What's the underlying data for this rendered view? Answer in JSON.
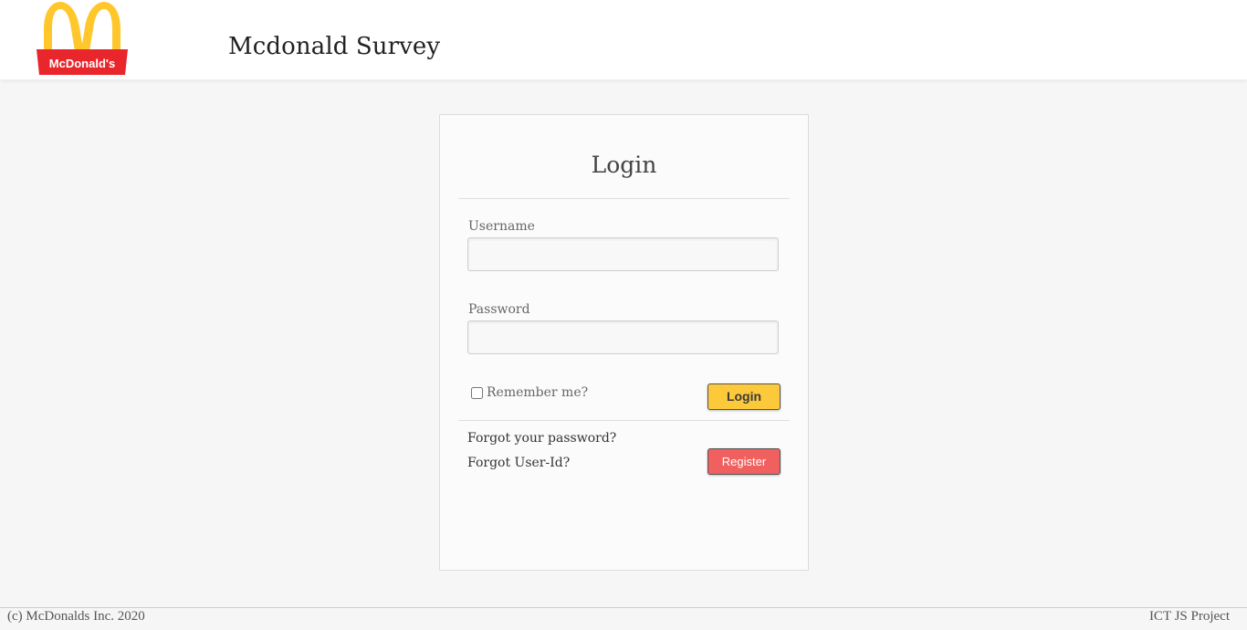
{
  "header": {
    "logo_text": "McDonald's",
    "site_title": "Mcdonald Survey"
  },
  "login_card": {
    "title": "Login",
    "username_label": "Username",
    "username_value": "",
    "password_label": "Password",
    "password_value": "",
    "remember_label": "Remember me?",
    "remember_checked": false,
    "login_button": "Login",
    "forgot_password_link": "Forgot your password?",
    "forgot_userid_link": "Forgot User-Id?",
    "register_button": "Register"
  },
  "footer": {
    "left_text": "(c) McDonalds Inc. 2020",
    "right_text": "ICT JS Project"
  },
  "colors": {
    "login_button": "#fcc93b",
    "register_button": "#f0605f",
    "logo_red": "#e8262c",
    "logo_yellow": "#ffc72c"
  }
}
